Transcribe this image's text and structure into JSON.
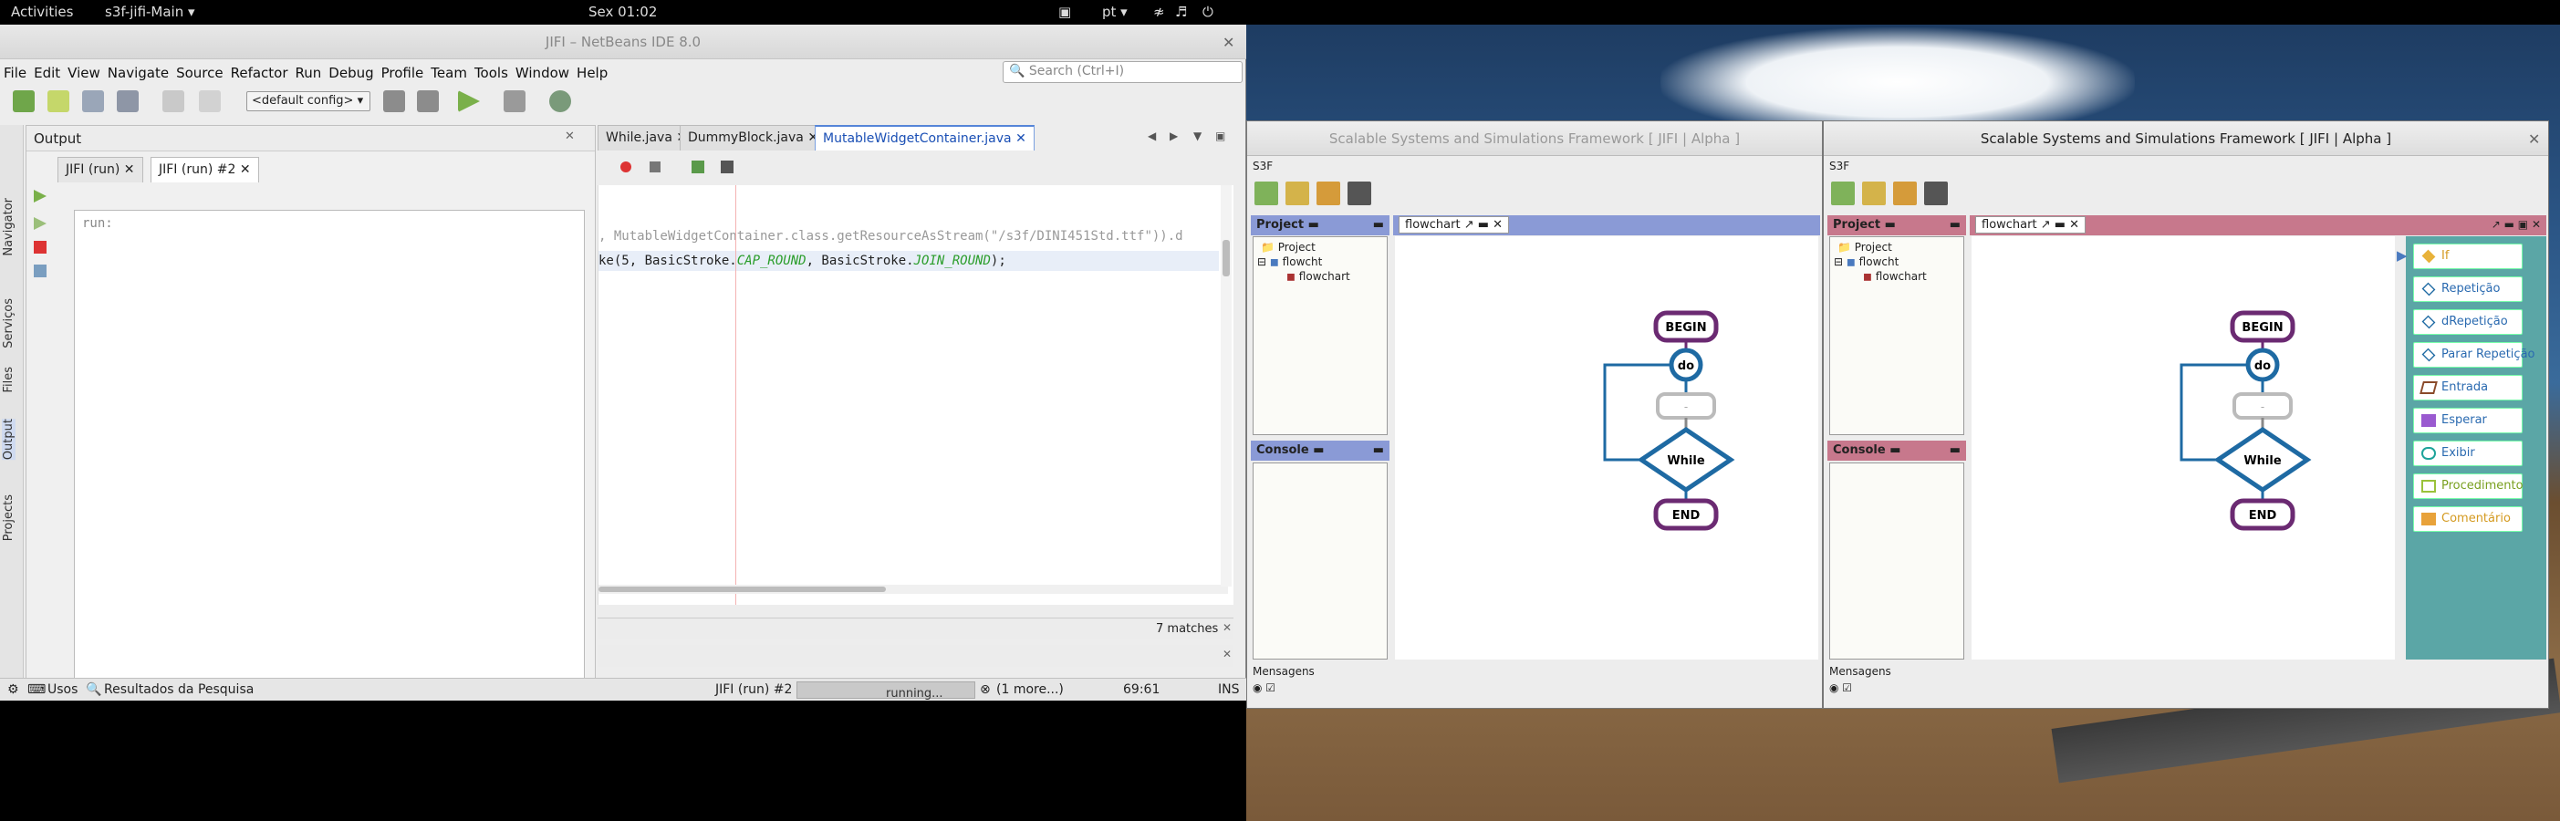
{
  "topbar": {
    "activities": "Activities",
    "app_menu": "s3f-jifi-Main ▾",
    "clock": "Sex 01:02",
    "lang": "pt ▾",
    "icons": [
      "vpn-icon",
      "wifi-icon",
      "volume-icon",
      "power-icon"
    ]
  },
  "netbeans": {
    "title": "JIFI – NetBeans IDE 8.0",
    "menu": [
      "File",
      "Edit",
      "View",
      "Navigate",
      "Source",
      "Refactor",
      "Run",
      "Debug",
      "Profile",
      "Team",
      "Tools",
      "Window",
      "Help"
    ],
    "search_placeholder": "Search (Ctrl+I)",
    "config": "<default config>",
    "editor_tabs": [
      "While.java",
      "DummyBlock.java",
      "MutableWidgetContainer.java"
    ],
    "side_tabs": [
      "Navigator",
      "Serviços",
      "Files",
      "Output",
      "Projects"
    ],
    "output": {
      "title": "Output",
      "tabs": [
        "JIFI (run)",
        "JIFI (run) #2"
      ],
      "text": "run:"
    },
    "code": {
      "line1": ", MutableWidgetContainer.class.getResourceAsStream(\"/s3f/DINI451Std.ttf\")).d",
      "line2_a": "ke(5, BasicStroke.",
      "line2_b": "CAP_ROUND",
      "line2_c": ", BasicStroke.",
      "line2_d": "JOIN_ROUND",
      "line2_e": ");"
    },
    "matches": "7 matches",
    "status": {
      "usos": "Usos",
      "resultados": "Resultados da Pesquisa",
      "task": "JIFI (run) #2",
      "progress_text": "running...",
      "more": "(1 more...)",
      "position": "69:61",
      "mode": "INS"
    }
  },
  "s3f": {
    "title": "Scalable Systems and Simulations Framework [ JIFI | Alpha ]",
    "menu": "S3F",
    "project_panel": "Project",
    "tree": {
      "root": "Project",
      "child": "flowcht",
      "leaf": "flowchart"
    },
    "console_panel": "Console",
    "canvas_tab": "flowchart",
    "messages": "Mensagens",
    "flow": {
      "begin": "BEGIN",
      "do": "do",
      "dot": "-",
      "while": "While",
      "end": "END"
    },
    "palette": [
      "If",
      "Repetição",
      "dRepetição",
      "Parar Repetição",
      "Entrada",
      "Esperar",
      "Exibir",
      "Procedimento",
      "Comentário"
    ]
  },
  "colors": {
    "s3f_blue_accent": "#8a9ad6",
    "s3f_pink_accent": "#c7788c",
    "palette_bg": "#5ba6a6",
    "flow_purple": "#6b2a72",
    "flow_blue": "#1e6aa3"
  }
}
